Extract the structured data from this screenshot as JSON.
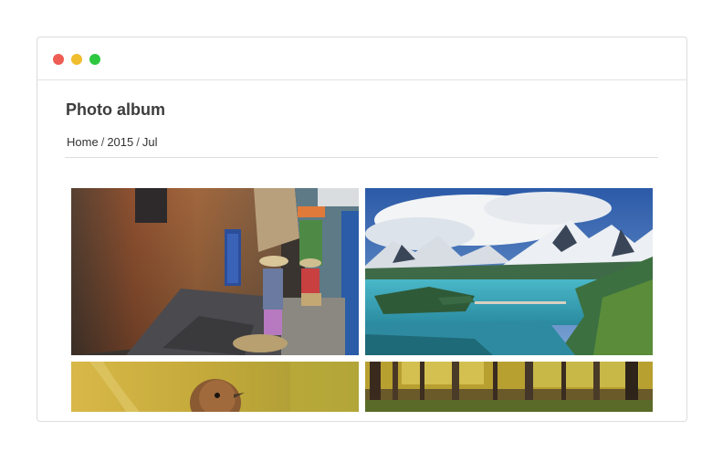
{
  "window": {
    "controls": [
      "close",
      "minimize",
      "maximize"
    ]
  },
  "page": {
    "title": "Photo album"
  },
  "breadcrumb": {
    "items": [
      "Home",
      "2015",
      "Jul"
    ],
    "separator": "/"
  },
  "photos": [
    {
      "subject": "street-scene-photo"
    },
    {
      "subject": "mountain-lake-photo"
    },
    {
      "subject": "bird-photo"
    },
    {
      "subject": "forest-photo"
    }
  ],
  "colors": {
    "close": "#ee5c54",
    "minimize": "#f0bd2d",
    "maximize": "#2dc840",
    "title_text": "#3d3d3d"
  }
}
